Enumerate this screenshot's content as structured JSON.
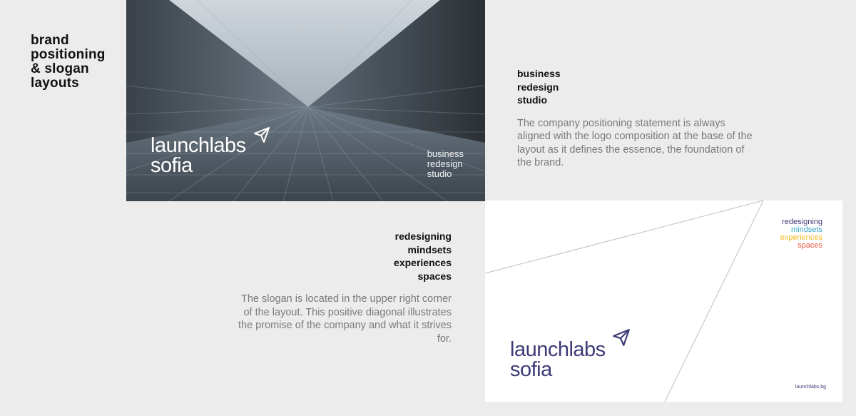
{
  "page": {
    "title_lines": [
      "brand",
      "positioning",
      "& slogan",
      "layouts"
    ]
  },
  "photo_card": {
    "logo_lines": [
      "launchlabs",
      "sofia"
    ],
    "tagline_lines": [
      "business",
      "redesign",
      "studio"
    ],
    "logo_icon": "paper-plane-icon"
  },
  "positioning": {
    "heading_lines": [
      "business",
      "redesign",
      "studio"
    ],
    "description": "The company positioning statement is always aligned with the logo composition at the base of the layout as it defines the essence, the foundation of the brand."
  },
  "slogan": {
    "heading_lines": [
      "redesigning",
      "mindsets",
      "experiences",
      "spaces"
    ],
    "description": "The slogan is located in the upper right corner of the layout. This positive diagonal illustrates the promise of the company and what it strives for."
  },
  "white_card": {
    "slogan_words": [
      {
        "text": "redesigning",
        "color": "#3e3a77"
      },
      {
        "text": "mindsets",
        "color": "#3aa6c9"
      },
      {
        "text": "experiences",
        "color": "#f2b81e"
      },
      {
        "text": "spaces",
        "color": "#e8553f"
      }
    ],
    "logo_lines": [
      "launchlabs",
      "sofia"
    ],
    "url": "launchlabs.bg",
    "brand_color": "#3e3a77",
    "logo_icon": "paper-plane-icon"
  }
}
